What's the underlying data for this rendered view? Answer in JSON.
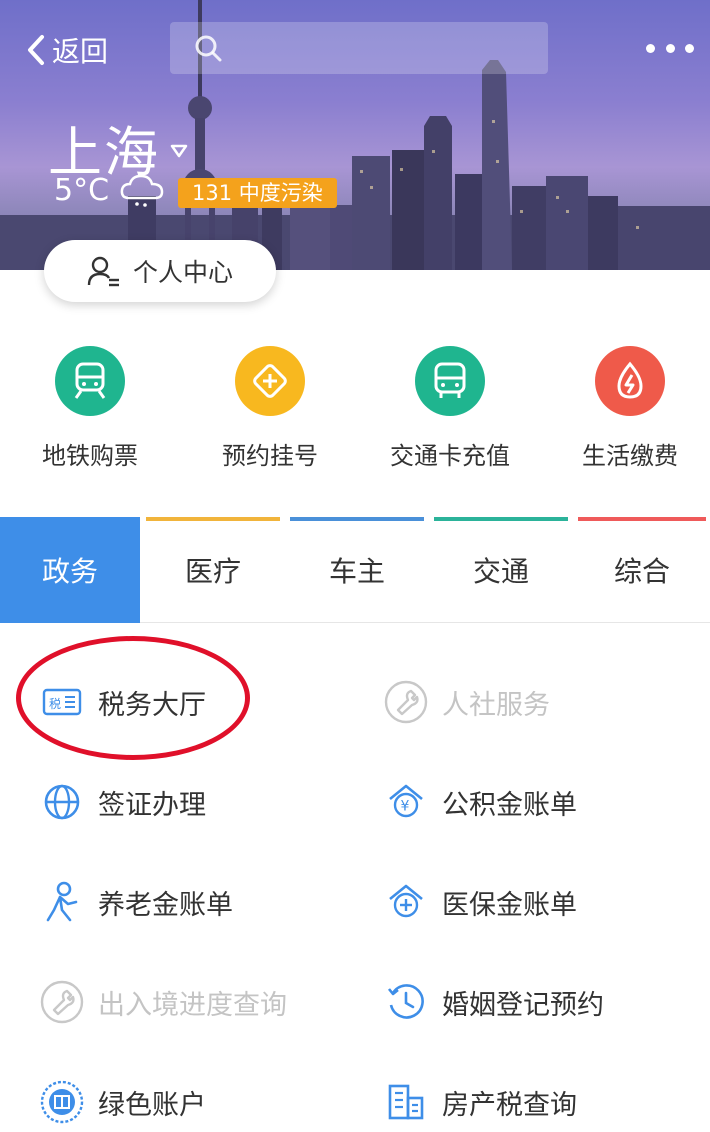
{
  "header": {
    "back_label": "返回",
    "city": "上海",
    "temperature": "5°C",
    "aqi": "131 中度污染",
    "aqi_color": "#f4a21c"
  },
  "personal_center": {
    "label": "个人中心"
  },
  "quick_services": [
    {
      "label": "地铁购票",
      "icon": "subway-icon",
      "color": "#1fb58f"
    },
    {
      "label": "预约挂号",
      "icon": "medical-cross-icon",
      "color": "#f8b81f"
    },
    {
      "label": "交通卡充值",
      "icon": "bus-icon",
      "color": "#1fb58f"
    },
    {
      "label": "生活缴费",
      "icon": "lightning-icon",
      "color": "#ef5a4a"
    }
  ],
  "tabs": [
    {
      "label": "政务",
      "active": true,
      "color": "#3e8ee8"
    },
    {
      "label": "医疗",
      "active": false,
      "color": "#f1b43b"
    },
    {
      "label": "车主",
      "active": false,
      "color": "#4a90d9"
    },
    {
      "label": "交通",
      "active": false,
      "color": "#2bb39a"
    },
    {
      "label": "综合",
      "active": false,
      "color": "#ef5a5a"
    }
  ],
  "services": [
    {
      "label": "税务大厅",
      "icon": "tax-icon",
      "enabled": true
    },
    {
      "label": "人社服务",
      "icon": "wrench-icon",
      "enabled": false
    },
    {
      "label": "签证办理",
      "icon": "globe-icon",
      "enabled": true
    },
    {
      "label": "公积金账单",
      "icon": "house-yuan-icon",
      "enabled": true
    },
    {
      "label": "养老金账单",
      "icon": "elderly-person-icon",
      "enabled": true
    },
    {
      "label": "医保金账单",
      "icon": "house-medical-icon",
      "enabled": true
    },
    {
      "label": "出入境进度查询",
      "icon": "wrench-icon",
      "enabled": false
    },
    {
      "label": "婚姻登记预约",
      "icon": "clock-history-icon",
      "enabled": true
    },
    {
      "label": "绿色账户",
      "icon": "green-badge-icon",
      "enabled": true
    },
    {
      "label": "房产税查询",
      "icon": "building-icon",
      "enabled": true
    }
  ],
  "annotation": {
    "color": "#e0102a"
  }
}
